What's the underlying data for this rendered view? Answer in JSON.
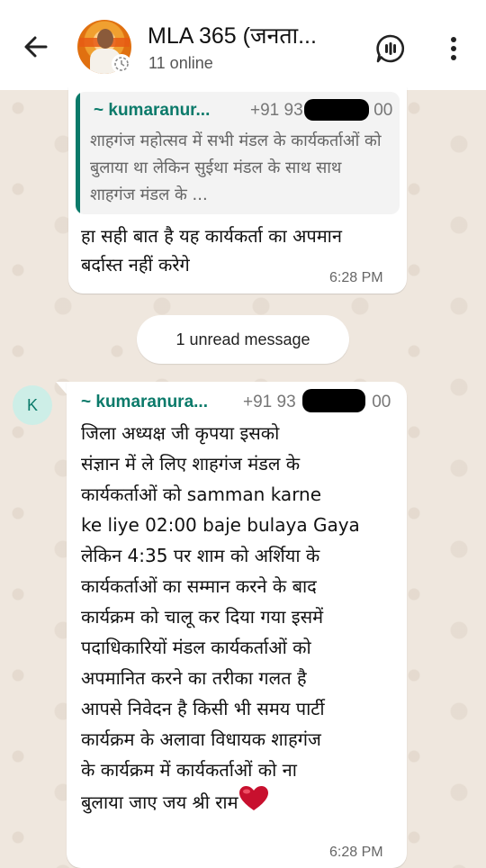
{
  "header": {
    "title": "MLA 365  (जनता...",
    "subtitle": "11 online"
  },
  "messages": {
    "first": {
      "quote_sender": "~ kumaranur...",
      "quote_phone": "+91 93",
      "quote_phone_end": "00",
      "quote_text": "शाहगंज महोत्सव में सभी मंडल के कार्यकर्ताओं को बुलाया था लेकिन सुईथा मंडल के साथ साथ शाहगंज मंडल के ...",
      "text": "हा सही बात है यह कार्यकर्ता का अपमान बर्दास्त नहीं करेगे",
      "time": "6:28 PM"
    },
    "unread": "1 unread message",
    "second": {
      "avatar_letter": "K",
      "sender": "~ kumaranura...",
      "phone": "+91 93",
      "phone_end": "00",
      "text": "जिला अध्यक्ष जी कृपया इसको\nसंज्ञान में ले लिए शाहगंज मंडल के\nकार्यकर्ताओं को samman karne\nke liye 02:00 baje bulaya Gaya\nलेकिन 4:35 पर शाम को अर्शिया के\nकार्यकर्ताओं का सम्मान करने के बाद\nकार्यक्रम को चालू कर दिया गया इसमें\nपदाधिकारियों मंडल कार्यकर्ताओं को\nअपमानित करने का तरीका गलत है\nआपसे निवेदन है किसी भी समय पार्टी\nकार्यक्रम के अलावा विधायक शाहगंज\nके कार्यक्रम में कार्यकर्ताओं को ना\nबुलाया जाए जय श्री राम",
      "time": "6:28 PM"
    }
  },
  "colors": {
    "accent": "#0b7a6a",
    "chat_bg": "#efe7de",
    "heart": "#c8102e"
  }
}
